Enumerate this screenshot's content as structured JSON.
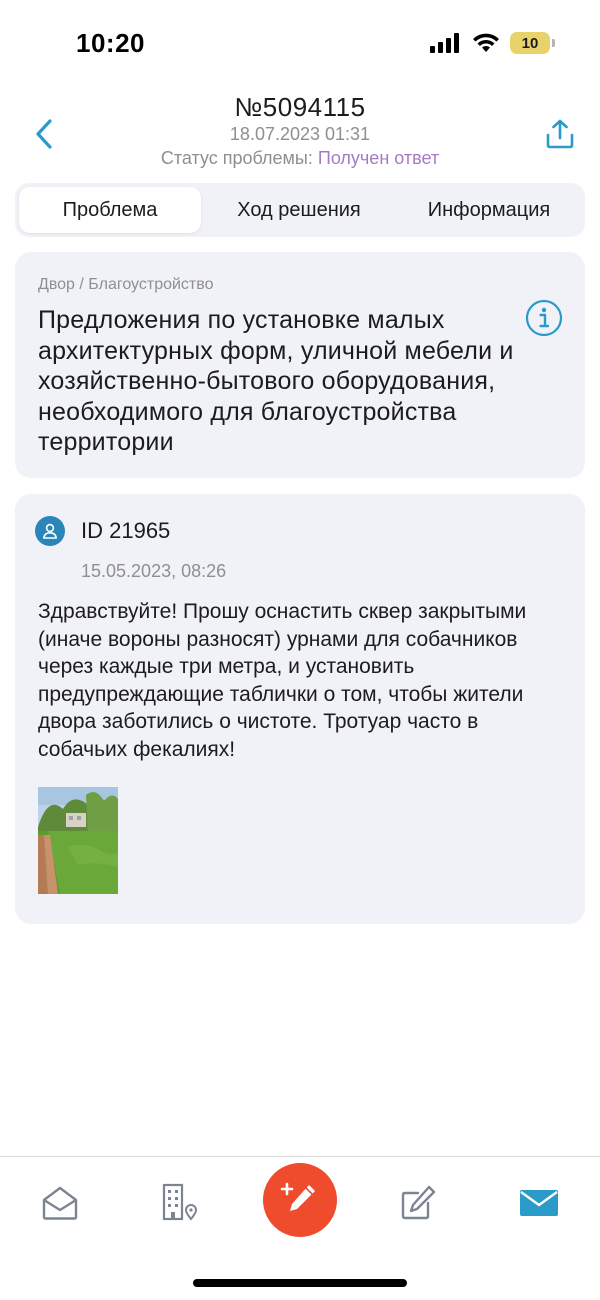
{
  "status_bar": {
    "time": "10:20",
    "battery_level": "10",
    "icons": [
      "cellular-signal-icon",
      "wifi-icon",
      "battery-icon"
    ]
  },
  "header": {
    "title": "№5094115",
    "date": "18.07.2023 01:31",
    "status_label": "Статус проблемы:",
    "status_value": "Получен ответ",
    "back_icon": "chevron-left-icon",
    "share_icon": "share-icon"
  },
  "tabs": [
    {
      "label": "Проблема",
      "active": true
    },
    {
      "label": "Ход решения",
      "active": false
    },
    {
      "label": "Информация",
      "active": false
    }
  ],
  "category": {
    "path": "Двор / Благоустройство",
    "title": "Предложения по установке малых архитектурных форм, уличной мебели и хозяйственно-бытового оборудования, необходимого для благоустройства территории"
  },
  "message": {
    "user_id": "ID 21965",
    "date": "15.05.2023, 08:26",
    "text": "Здравствуйте! Прошу оснастить сквер закрытыми (иначе вороны разносят) урнами для собачников через каждые три метра, и установить предупреждающие таблички о том, чтобы жители двора заботились о чистоте. Тротуар часто в собачьих фекалиях!"
  },
  "bottom_nav": {
    "items": [
      "home-icon",
      "building-location-icon",
      "add-problem-icon",
      "edit-icon",
      "mail-icon"
    ]
  },
  "colors": {
    "accent": "#2a9ac9",
    "status_value": "#a37cc4",
    "fab": "#ef4c2e",
    "card_bg": "#f1f2f7"
  }
}
